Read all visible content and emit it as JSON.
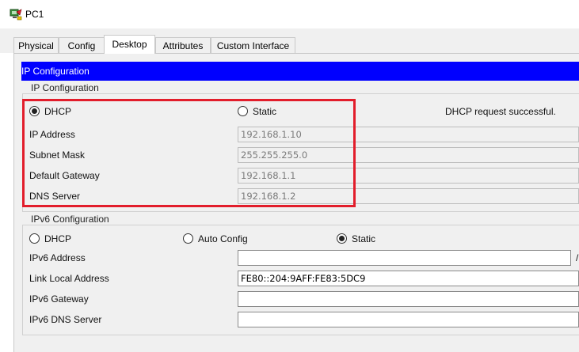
{
  "window": {
    "title": "PC1",
    "icon": "pc-icon"
  },
  "tabs": [
    {
      "label": "Physical",
      "active": false
    },
    {
      "label": "Config",
      "active": false
    },
    {
      "label": "Desktop",
      "active": true
    },
    {
      "label": "Attributes",
      "active": false
    },
    {
      "label": "Custom Interface",
      "active": false
    }
  ],
  "panel": {
    "header": "IP Configuration"
  },
  "ipv4": {
    "section_title": "IP Configuration",
    "dhcp_label": "DHCP",
    "static_label": "Static",
    "mode": "DHCP",
    "status": "DHCP request successful.",
    "ip_address_label": "IP Address",
    "ip_address": "192.168.1.10",
    "subnet_mask_label": "Subnet Mask",
    "subnet_mask": "255.255.255.0",
    "default_gateway_label": "Default Gateway",
    "default_gateway": "192.168.1.1",
    "dns_server_label": "DNS Server",
    "dns_server": "192.168.1.2",
    "highlight_color": "#e21d2b"
  },
  "ipv6": {
    "section_title": "IPv6 Configuration",
    "dhcp_label": "DHCP",
    "auto_config_label": "Auto Config",
    "static_label": "Static",
    "mode": "Static",
    "ipv6_address_label": "IPv6 Address",
    "ipv6_address": "",
    "prefix_separator": "/",
    "link_local_label": "Link Local Address",
    "link_local_address": "FE80::204:9AFF:FE83:5DC9",
    "gateway_label": "IPv6 Gateway",
    "gateway": "",
    "dns_server_label": "IPv6 DNS Server",
    "dns_server": ""
  },
  "colors": {
    "header_bg": "#0000ff",
    "header_text": "#ffffff",
    "panel_bg": "#f0f0f0"
  }
}
